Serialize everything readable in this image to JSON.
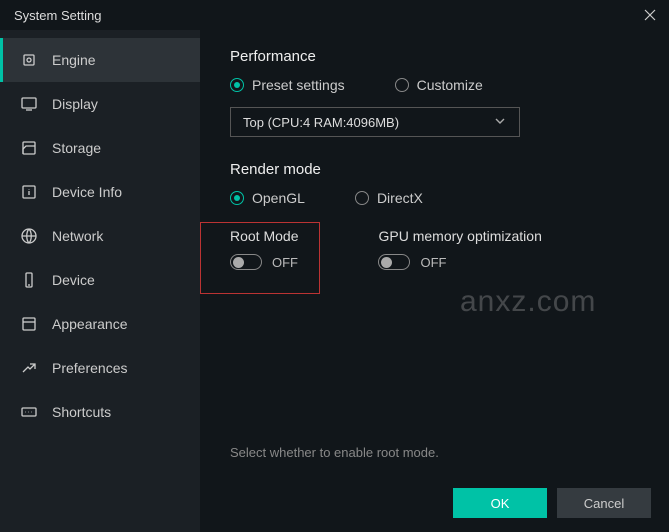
{
  "title": "System Setting",
  "sidebar": {
    "items": [
      {
        "label": "Engine"
      },
      {
        "label": "Display"
      },
      {
        "label": "Storage"
      },
      {
        "label": "Device Info"
      },
      {
        "label": "Network"
      },
      {
        "label": "Device"
      },
      {
        "label": "Appearance"
      },
      {
        "label": "Preferences"
      },
      {
        "label": "Shortcuts"
      }
    ]
  },
  "performance": {
    "title": "Performance",
    "preset_label": "Preset settings",
    "customize_label": "Customize",
    "dropdown_value": "Top (CPU:4 RAM:4096MB)"
  },
  "render": {
    "title": "Render mode",
    "opengl_label": "OpenGL",
    "directx_label": "DirectX"
  },
  "root": {
    "title": "Root Mode",
    "state": "OFF"
  },
  "gpu": {
    "title": "GPU memory optimization",
    "state": "OFF"
  },
  "hint": "Select whether to enable root mode.",
  "buttons": {
    "ok": "OK",
    "cancel": "Cancel"
  },
  "watermark": "anxz.com"
}
